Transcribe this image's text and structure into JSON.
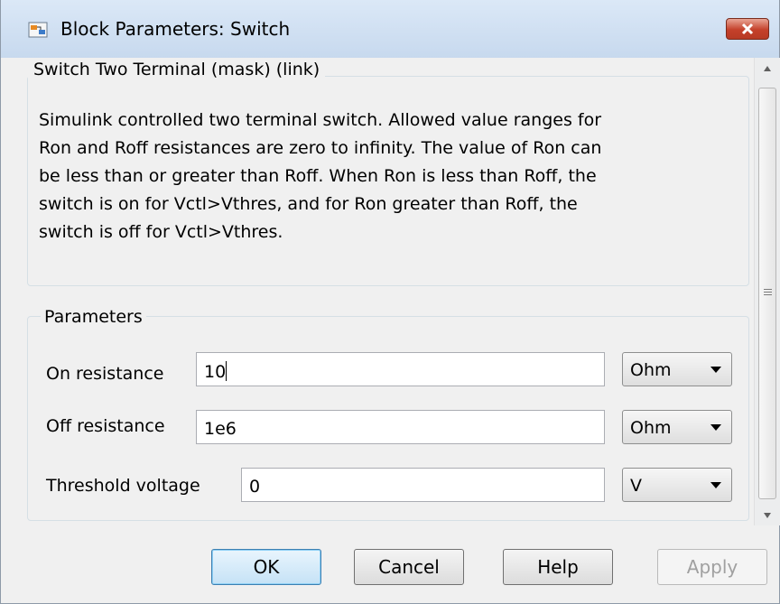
{
  "window": {
    "title": "Block Parameters: Switch"
  },
  "description_group": {
    "legend": "Switch Two Terminal (mask) (link)",
    "text": "Simulink controlled two terminal switch. Allowed value ranges for\nRon and Roff resistances are zero to infinity. The value of Ron can\nbe less than or greater than Roff. When Ron is less than Roff, the\nswitch is on for Vctl>Vthres, and for Ron greater than Roff, the\nswitch is off for Vctl>Vthres."
  },
  "parameters": {
    "legend": "Parameters",
    "rows": [
      {
        "label": "On resistance",
        "value": "10",
        "unit": "Ohm"
      },
      {
        "label": "Off resistance",
        "value": "1e6",
        "unit": "Ohm"
      },
      {
        "label": "Threshold voltage",
        "value": "0",
        "unit": "V"
      }
    ]
  },
  "buttons": {
    "ok": "OK",
    "cancel": "Cancel",
    "help": "Help",
    "apply": "Apply"
  },
  "colors": {
    "close_button": "#c4402a",
    "default_button_border": "#3c7fb1"
  }
}
